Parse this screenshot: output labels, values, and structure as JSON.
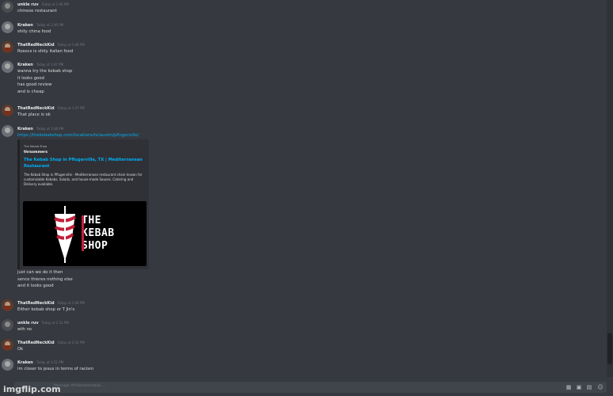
{
  "messages": [
    {
      "user": "unkle ruv",
      "ts": "Today at 1:46 PM",
      "lines": [
        "chinese restaurant"
      ]
    },
    {
      "user": "Kraken",
      "ts": "Today at 1:46 PM",
      "lines": [
        "shity china food"
      ]
    },
    {
      "user": "ThatRedNeckKid",
      "ts": "Today at 1:46 PM",
      "lines": [
        "Rosecs is shity italian food"
      ]
    },
    {
      "user": "Kraken",
      "ts": "Today at 1:47 PM",
      "lines": [
        "wanna try the kebab shop",
        "it looks good",
        "has good review",
        "and is cheap"
      ]
    },
    {
      "user": "ThatRedNeckKid",
      "ts": "Today at 1:47 PM",
      "lines": [
        "That place is ok"
      ]
    },
    {
      "user": "Kraken",
      "ts": "Today at 1:48 PM",
      "lines": [],
      "link": "https://thekebabshop.com/locations/tx/austin/pflugerville/"
    },
    {
      "user": "ThatRedNeckKid",
      "ts": "Today at 1:49 PM",
      "lines": [
        "Either kebab shop or T Jin's"
      ]
    },
    {
      "user": "unkle ruv",
      "ts": "Today at 2:31 PM",
      "lines": [
        "wth no"
      ]
    },
    {
      "user": "ThatRedNeckKid",
      "ts": "Today at 2:31 PM",
      "lines": [
        "Ok"
      ]
    },
    {
      "user": "Kraken",
      "ts": "Today at 2:51 PM",
      "lines": [
        "im closer to jesus in terms of racism"
      ]
    }
  ],
  "after_embed_lines": [
    "just can we do it then",
    "sence thieres nothing else",
    "and it looks good"
  ],
  "embed": {
    "provider": "The Kebab Shop",
    "author": "thrsommers",
    "title": "The Kebab Shop in Pflugerville, TX | Mediterranean Restaurant",
    "description": "The Kebab Shop in Pflugerville - Mediterranean restaurant chain known for customizable Kebabs, Salads, and house-made Sauces. Catering and Delivery available.",
    "logo_letters": [
      "THE",
      "KEBAB",
      "SHOP"
    ]
  },
  "input": {
    "placeholder": "Message #thatredneckkid, ..."
  },
  "watermark": "imgflip.com",
  "colors": {
    "link": "#00aff4",
    "background": "#36393f",
    "logo_red": "#c21f3a"
  }
}
